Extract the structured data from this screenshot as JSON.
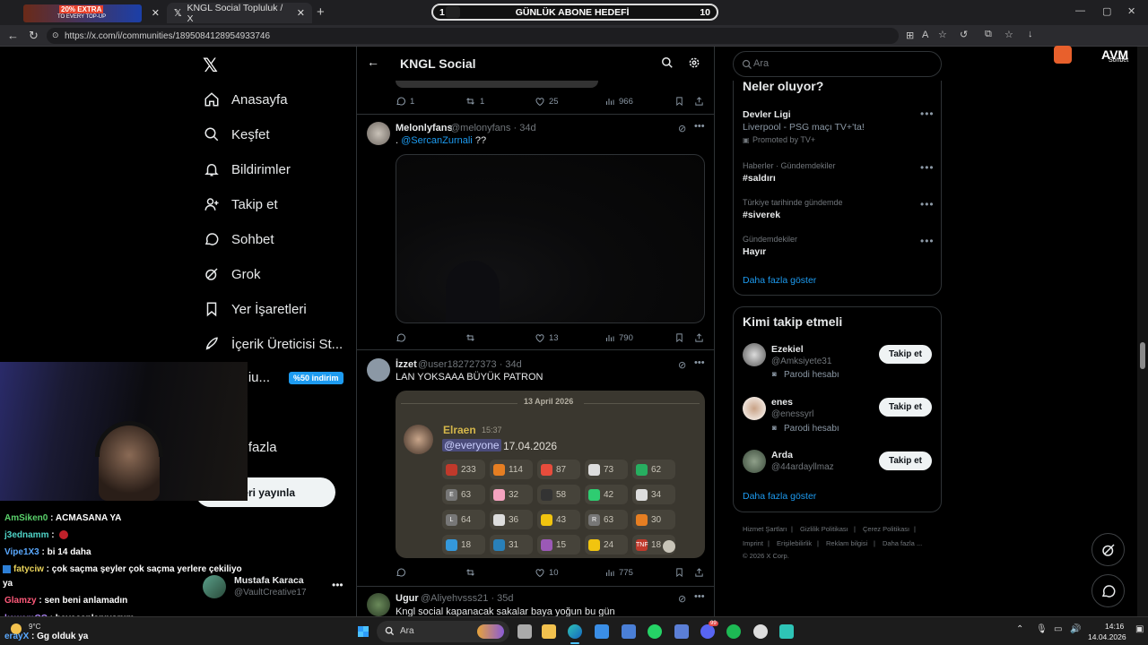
{
  "browser": {
    "tab1_label": "KNGL Social Topluluk / X",
    "tab0_ad": "20% EXTRA",
    "tab0_ad_sub": "TO EVERY TOP-UP",
    "url": "https://x.com/i/communities/1895084128954933746",
    "extension_label": "AVM",
    "sohbet_label": "Sohbet"
  },
  "goal": {
    "left": "1",
    "title": "GÜNLÜK ABONE HEDEFİ",
    "right": "10"
  },
  "nav": {
    "home": "Anasayfa",
    "explore": "Keşfet",
    "notifications": "Bildirimler",
    "follow": "Takip et",
    "chat": "Sohbet",
    "grok": "Grok",
    "bookmarks": "Yer İşaretleri",
    "creator": "İçerik Üreticisi St...",
    "premium": "emiu...",
    "premium_badge": "%50 indirim",
    "profile": "ofil",
    "more": "ha fazla",
    "post_button": "deri yayınla"
  },
  "account": {
    "name": "Mustafa Karaca",
    "handle": "@VaultCreative17"
  },
  "header": {
    "title": "KNGL Social"
  },
  "posts": [
    {
      "stats": {
        "reply": "1",
        "repost": "1",
        "like": "25",
        "views": "966"
      }
    },
    {
      "name": "Melonlyfans",
      "handle": "@melonyfans",
      "time": "· 34d",
      "text_mention": "@SercanZurnali",
      "text_pre": ". ",
      "text_post": " ??",
      "stats": {
        "reply": "",
        "repost": "",
        "like": "13",
        "views": "790"
      }
    },
    {
      "name": "İzzet",
      "handle": "@user182727373",
      "time": "· 34d",
      "text": "LAN YOKSAAA BÜYÜK PATRON",
      "embed": {
        "date": "13 April 2026",
        "author": "Elraen",
        "time": "15:37",
        "mention": "@everyone",
        "msg": "17.04.2026",
        "reactions": [
          "233",
          "114",
          "87",
          "73",
          "62",
          "63",
          "32",
          "58",
          "42",
          "34",
          "64",
          "36",
          "43",
          "63",
          "30",
          "18",
          "31",
          "15",
          "24",
          "18"
        ],
        "reaction_labels": [
          "",
          "",
          "",
          "",
          "",
          "E",
          "",
          "",
          "",
          "",
          "L",
          "",
          "",
          "R",
          "",
          "",
          "",
          "",
          "",
          "TNF"
        ]
      },
      "stats": {
        "reply": "",
        "repost": "",
        "like": "10",
        "views": "775"
      }
    },
    {
      "name": "Ugur",
      "handle": "@Aliyehvsss21",
      "time": "· 35d",
      "text": "Kngl social kapanacak sakalar baya yoğun bu gün"
    }
  ],
  "search": {
    "placeholder": "Ara"
  },
  "trends": {
    "heading": "Neler oluyor?",
    "items": [
      {
        "meta": "",
        "title": "Devler Ligi",
        "sub": "Liverpool - PSG maçı TV+'ta!",
        "promo": "Promoted by TV+"
      },
      {
        "meta": "Haberler · Gündemdekiler",
        "title": "#saldırı"
      },
      {
        "meta": "Türkiye tarihinde gündemde",
        "title": "#siverek"
      },
      {
        "meta": "Gündemdekiler",
        "title": "Hayır"
      }
    ],
    "more": "Daha fazla göster"
  },
  "who_to_follow": {
    "heading": "Kimi takip etmeli",
    "users": [
      {
        "name": "Ezekiel",
        "handle": "@Amksiyete31",
        "badge": "Parodi hesabı",
        "button": "Takip et"
      },
      {
        "name": "enes",
        "handle": "@enessyrl",
        "badge": "Parodi hesabı",
        "button": "Takip et"
      },
      {
        "name": "Arda",
        "handle": "@44ardayllmaz",
        "button": "Takip et"
      }
    ],
    "more": "Daha fazla göster"
  },
  "footer": {
    "l1": [
      "Hizmet Şartları",
      "Gizlilik Politikası",
      "Çerez Politikası"
    ],
    "l2": [
      "Imprint",
      "Erişilebilirlik",
      "Reklam bilgisi",
      "Daha fazla ..."
    ],
    "copy": "© 2026 X Corp."
  },
  "chat": [
    {
      "user": "AmSiken0",
      "color": "#5ad16b",
      "msg": " : ACMASANA YA"
    },
    {
      "user": "j3ednamm",
      "color": "#4fd4c8",
      "msg": " : "
    },
    {
      "user": "Vipe1X3",
      "color": "#5aa9ff",
      "msg": " : bi 14 daha"
    },
    {
      "user": "fatyciw",
      "color": "#e8d25a",
      "msg": " : çok saçma şeyler çok saçma yerlere çekiliyo"
    },
    {
      "user": "",
      "color": "#fff",
      "msg": "ya"
    },
    {
      "user": "Glamzy",
      "color": "#ff5a7a",
      "msg": " : sen beni anlamadın"
    },
    {
      "user": "kewemCC",
      "color": "#b58cff",
      "msg": " : heyecanlanıyorum"
    },
    {
      "user": "erayX",
      "color": "#5aa9ff",
      "msg": " : Gg olduk ya"
    }
  ],
  "taskbar": {
    "search": "Ara",
    "temp": "9°C",
    "time": "14:16",
    "date": "14.04.2026",
    "badge": "99"
  },
  "colors": {
    "accent": "#1d9bf0",
    "bg": "#000000",
    "border": "#2f3336",
    "premium": "#1d9bf0"
  }
}
